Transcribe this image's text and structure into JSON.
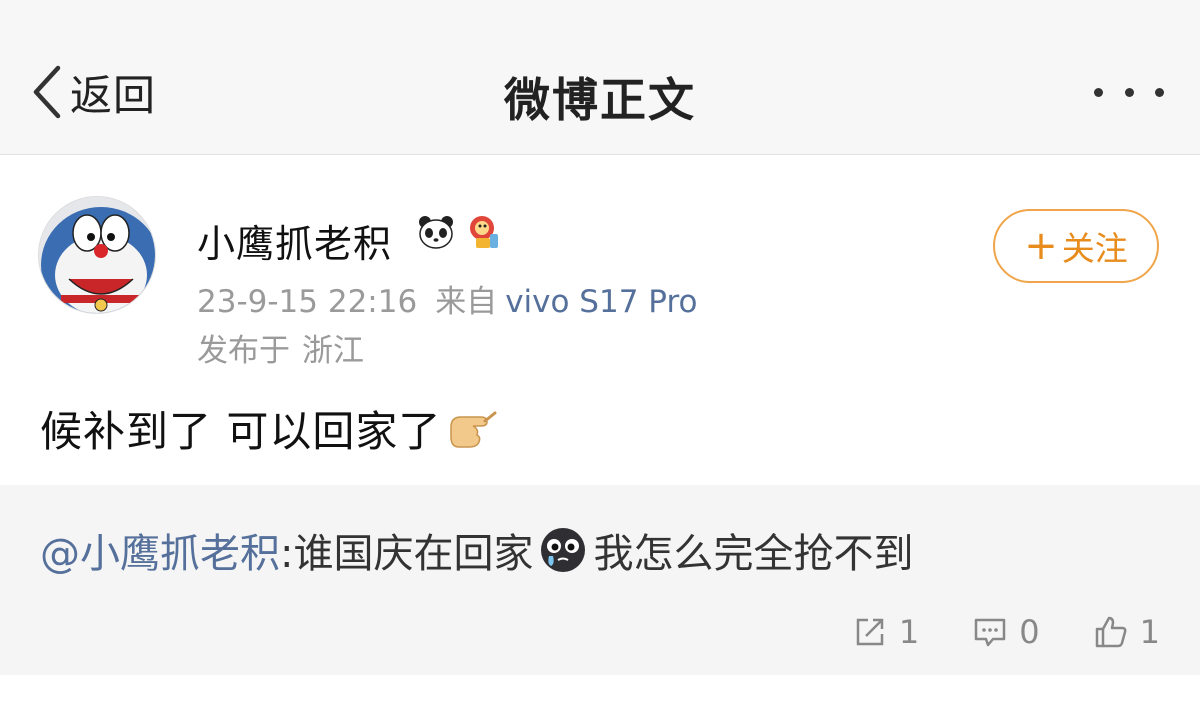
{
  "nav": {
    "back_label": "返回",
    "title": "微博正文",
    "more_icon": "more-dots-icon"
  },
  "post": {
    "author": {
      "name": "小鹰抓老积",
      "badges": [
        "panda-badge-icon",
        "mascot-badge-icon"
      ]
    },
    "time": "23-9-15 22:16",
    "source_label": "来自",
    "device": "vivo S17 Pro",
    "location_label": "发布于",
    "location": "浙江",
    "follow_label": "关注",
    "text": "候补到了 可以回家了",
    "text_emoji": "pointing-hand-emoji"
  },
  "repost": {
    "mention": "@小鹰抓老积",
    "text_before": ":谁国庆在回家",
    "emoji": "crying-face-emoji",
    "text_after": "我怎么完全抢不到"
  },
  "actions": {
    "repost_count": "1",
    "comment_count": "0",
    "like_count": "1"
  },
  "colors": {
    "accent_orange": "#e88c1e",
    "link_blue": "#55709a",
    "meta_gray": "#9a9a9a",
    "repost_bg": "#f5f5f5"
  }
}
